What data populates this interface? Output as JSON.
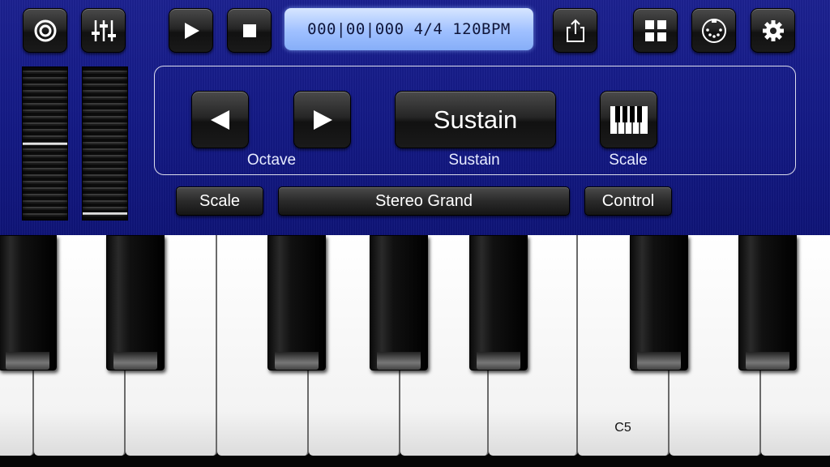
{
  "toolbar": {
    "power_icon": "power-icon",
    "mixer_icon": "mixer-sliders-icon",
    "play_icon": "play-icon",
    "stop_icon": "stop-icon",
    "share_icon": "share-icon",
    "grid_icon": "grid-icon",
    "midi_icon": "midi-connector-icon",
    "settings_icon": "gear-icon"
  },
  "transport": {
    "display": "000|00|000 4/4 120BPM"
  },
  "sliders": {
    "left_level": 0.5,
    "right_level": 0.03
  },
  "controls": {
    "sustain_button": "Sustain",
    "octave_caption": "Octave",
    "sustain_caption": "Sustain",
    "scale_caption": "Scale"
  },
  "bar": {
    "scale": "Scale",
    "instrument": "Stereo Grand",
    "control": "Control"
  },
  "keyboard": {
    "label": "C5"
  },
  "colors": {
    "panel": "#141a86",
    "lcd": "#9fc0ff"
  }
}
